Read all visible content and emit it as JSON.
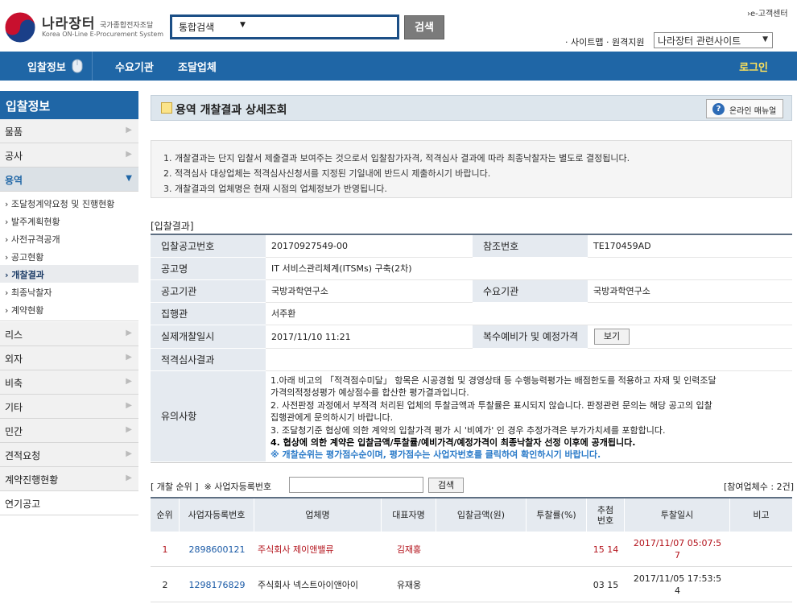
{
  "header": {
    "logo_title": "나라장터",
    "logo_sub_kr": "국가종합전자조달",
    "logo_sub_en": "Korea ON-Line E-Procurement System",
    "search_category": "통합검색",
    "search_button": "검색",
    "customer_center": "›e-고객센터",
    "util_links": "· 사이트맵 · 원격지원",
    "related_site_select": "나라장터 관련사이트"
  },
  "nav": {
    "items": [
      "입찰정보",
      "수요기관",
      "조달업체"
    ],
    "login": "로그인"
  },
  "sidebar": {
    "title": "입찰정보",
    "top_items": [
      "물품",
      "공사",
      "용역"
    ],
    "sub_items": [
      "› 조달청계약요청 및 진행현황",
      "› 발주계획현황",
      "› 사전규격공개",
      "› 공고현황",
      "› 개찰결과",
      "› 최종낙찰자",
      "› 계약현황"
    ],
    "bottom_items": [
      "리스",
      "외자",
      "비축",
      "기타",
      "민간",
      "견적요청",
      "계약진행현황",
      "연기공고"
    ]
  },
  "page": {
    "title": "용역 개찰결과 상세조회",
    "manual_button": "온라인 매뉴얼",
    "notices": [
      "1. 개찰결과는 단지 입찰서 제출결과 보여주는 것으로서 입찰참가자격, 적격심사 결과에 따라 최종낙찰자는 별도로 결정됩니다.",
      "2. 적격심사 대상업체는 적격심사신청서를 지정된 기일내에 반드시 제출하시기 바랍니다.",
      "3. 개찰결과의 업체명은 현재 시점의 업체정보가 반영됩니다."
    ]
  },
  "result": {
    "section_title": "[입찰결과]",
    "labels": {
      "notice_no": "입찰공고번호",
      "ref_no": "참조번호",
      "notice_name": "공고명",
      "notice_org": "공고기관",
      "demand_org": "수요기관",
      "executor": "집행관",
      "open_datetime": "실제개찰일시",
      "multi_price": "복수예비가 및 예정가격",
      "qualification": "적격심사결과",
      "notes": "유의사항"
    },
    "values": {
      "notice_no": "20170927549-00",
      "ref_no": "TE170459AD",
      "notice_name": "IT 서비스관리체계(ITSMs) 구축(2차)",
      "notice_org": "국방과학연구소",
      "demand_org": "국방과학연구소",
      "executor": "서주환",
      "open_datetime": "2017/11/10 11:21",
      "view_button": "보기",
      "qualification": ""
    },
    "notes": [
      "1.아래 비고의 「적격점수미달」 항목은 시공경험 및 경영상태 등 수행능력평가는 배점한도를 적용하고 자재 및 인력조달",
      "가격의적정성평가 예상점수를 합산한 평가결과입니다.",
      "2. 사전판정 과정에서 부적격 처리된 업체의 투찰금액과 투찰률은 표시되지 않습니다. 판정관련 문의는 해당 공고의 입찰",
      "집행관에게 문의하시기 바랍니다.",
      "3. 조달청기준 협상에 의한 계약의 입찰가격 평가 시 '비예가' 인 경우 추정가격은 부가가치세를 포함합니다.",
      "4. 협상에 의한 계약은 입찰금액/투찰률/예비가격/예정가격이 최종낙찰자 선정 이후에 공개됩니다.",
      "※ 개찰순위는 평가점수순이며, 평가점수는 사업자번호를 클릭하여 확인하시기 바랍니다."
    ]
  },
  "ranking": {
    "title": "[ 개찰 순위 ]",
    "reg_no_label": "※ 사업자등록번호",
    "search_button": "검색",
    "bidder_count": "[참여업체수 : 2건]",
    "columns": [
      "순위",
      "사업자등록번호",
      "업체명",
      "대표자명",
      "입찰금액(원)",
      "투찰률(%)",
      "추첨번호",
      "투찰일시",
      "비고"
    ],
    "rows": [
      {
        "rank": "1",
        "reg_no": "2898600121",
        "company": "주식회사 제이앤밸류",
        "ceo": "김재홍",
        "amount": "",
        "rate": "",
        "lottery": "15 14",
        "datetime": "2017/11/07 05:07:57",
        "note": ""
      },
      {
        "rank": "2",
        "reg_no": "1298176829",
        "company": "주식회사 넥스트아이앤아이",
        "ceo": "유재웅",
        "amount": "",
        "rate": "",
        "lottery": "03 15",
        "datetime": "2017/11/05 17:53:54",
        "note": ""
      }
    ]
  },
  "colors": {
    "nav_blue": "#1f66a6",
    "winner_red": "#b3121b",
    "link_blue": "#1a5aa6",
    "login_yellow": "#ffe25a"
  }
}
